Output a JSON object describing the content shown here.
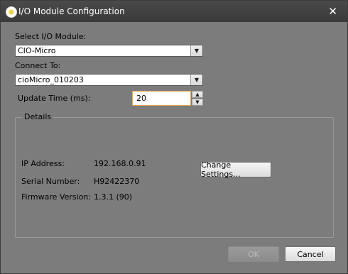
{
  "window": {
    "title": "I/O Module Configuration"
  },
  "select_module": {
    "label": "Select I/O Module:",
    "value": "CIO-Micro"
  },
  "connect_to": {
    "label": "Connect To:",
    "value": "cioMicro_010203"
  },
  "update_time": {
    "label": "Update Time (ms):",
    "value": "20"
  },
  "details": {
    "title": "Details",
    "rows": [
      {
        "label": "IP Address:",
        "value": "192.168.0.91"
      },
      {
        "label": "Serial Number:",
        "value": "H92422370"
      },
      {
        "label": "Firmware Version:",
        "value": "1.3.1 (90)"
      }
    ],
    "change_settings_label": "Change Settings..."
  },
  "buttons": {
    "ok_label": "OK",
    "cancel_label": "Cancel"
  },
  "icons": {
    "close": "close-icon",
    "app": "app-icon",
    "dropdown": "chevron-down-icon"
  }
}
